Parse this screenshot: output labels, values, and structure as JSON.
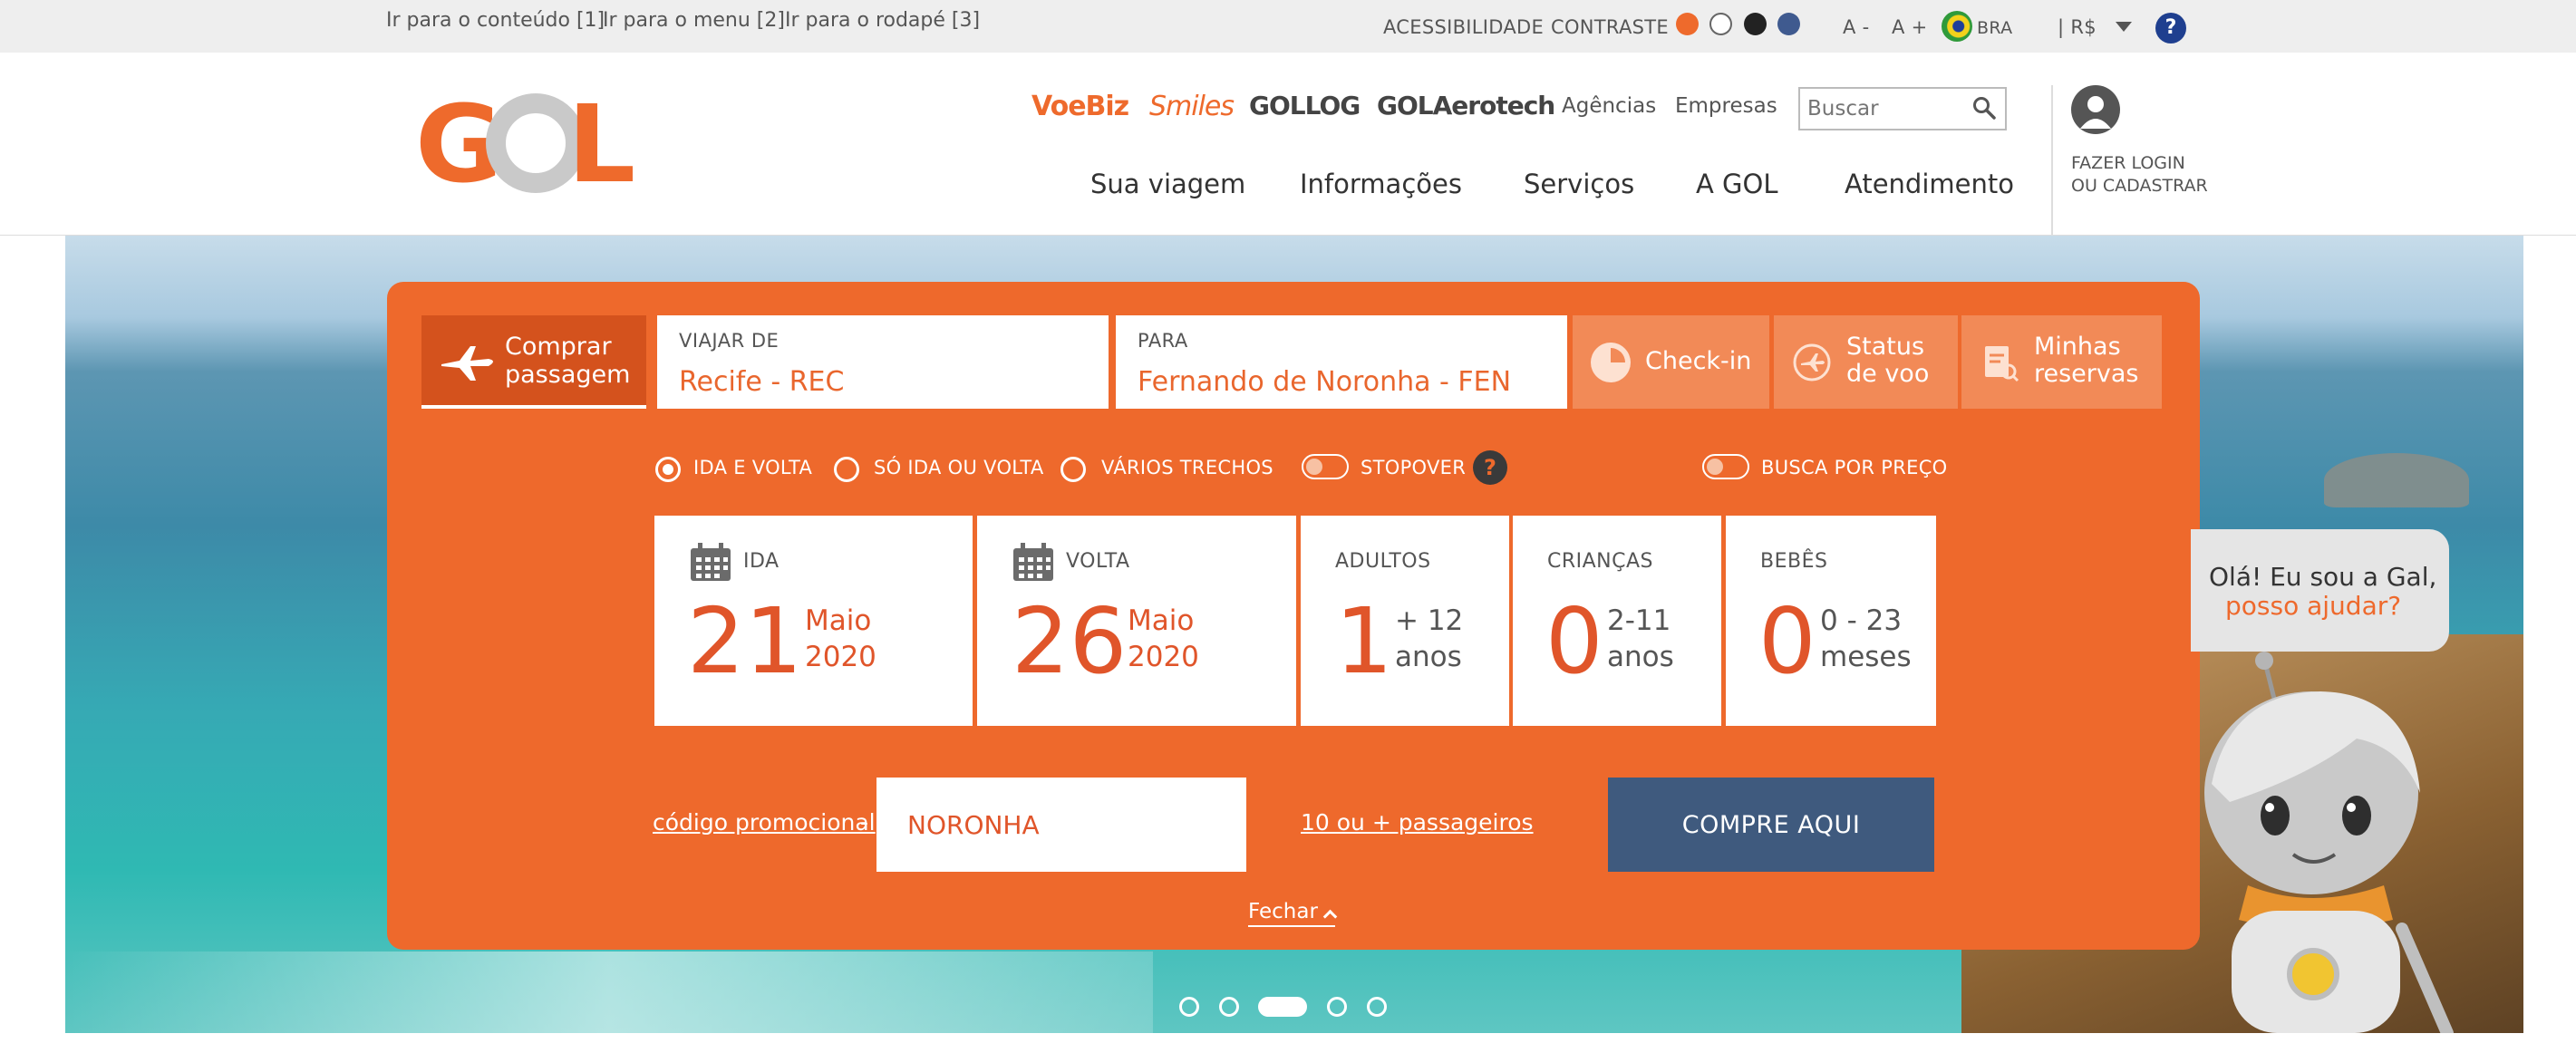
{
  "skip_links": [
    "Ir para o conteúdo [1]",
    "Ir para o menu [2]",
    "Ir para o rodapé [3]"
  ],
  "utility": {
    "accessibility": "ACESSIBILIDADE",
    "contrast": "CONTRASTE",
    "contrast_colors": [
      "#ee6a2c",
      "#ffffff",
      "#222222",
      "#3f5a8f"
    ],
    "font_decrease": "A -",
    "font_increase": "A +",
    "country": "BRA",
    "currency": "| R$",
    "help": "?"
  },
  "header": {
    "brands": [
      "VoeBiz",
      "Smiles",
      "GOLLOG",
      "GOLAerotech"
    ],
    "links": [
      "Agências",
      "Empresas"
    ],
    "search_placeholder": "Buscar",
    "nav": [
      "Sua viagem",
      "Informações",
      "Serviços",
      "A GOL",
      "Atendimento"
    ],
    "login_line1": "FAZER LOGIN",
    "login_line2": "OU CADASTRAR"
  },
  "booking": {
    "tab_buy_line1": "Comprar",
    "tab_buy_line2": "passagem",
    "from": {
      "label": "VIAJAR DE",
      "value": "Recife - REC"
    },
    "to": {
      "label": "PARA",
      "value": "Fernando de Noronha - FEN"
    },
    "checkin": "Check-in",
    "status_line1": "Status",
    "status_line2": "de voo",
    "reservas_line1": "Minhas",
    "reservas_line2": "reservas",
    "trip_types": [
      "IDA E VOLTA",
      "SÓ IDA OU VOLTA",
      "VÁRIOS TRECHOS"
    ],
    "selected_trip_type": "IDA E VOLTA",
    "stopover": "STOPOVER",
    "stopover_help": "?",
    "price_search": "BUSCA POR PREÇO",
    "departure": {
      "label": "IDA",
      "day": "21",
      "month": "Maio",
      "year": "2020"
    },
    "return": {
      "label": "VOLTA",
      "day": "26",
      "month": "Maio",
      "year": "2020"
    },
    "adults": {
      "label": "ADULTOS",
      "count": "1",
      "line1": "+ 12",
      "line2": "anos"
    },
    "children": {
      "label": "CRIANÇAS",
      "count": "0",
      "line1": "2-11",
      "line2": "anos"
    },
    "babies": {
      "label": "BEBÊS",
      "count": "0",
      "line1": "0 - 23",
      "line2": "meses"
    },
    "promo_label": "código promocional",
    "promo_dash": "-",
    "promo_value": "NORONHA",
    "group_link": "10 ou + passageiros",
    "buy_button": "COMPRE AQUI",
    "close": "Fechar"
  },
  "chat": {
    "line1": "Olá! Eu sou a Gal,",
    "line2": "posso ajudar?"
  },
  "carousel": {
    "slides": 5,
    "active_index": 2
  }
}
